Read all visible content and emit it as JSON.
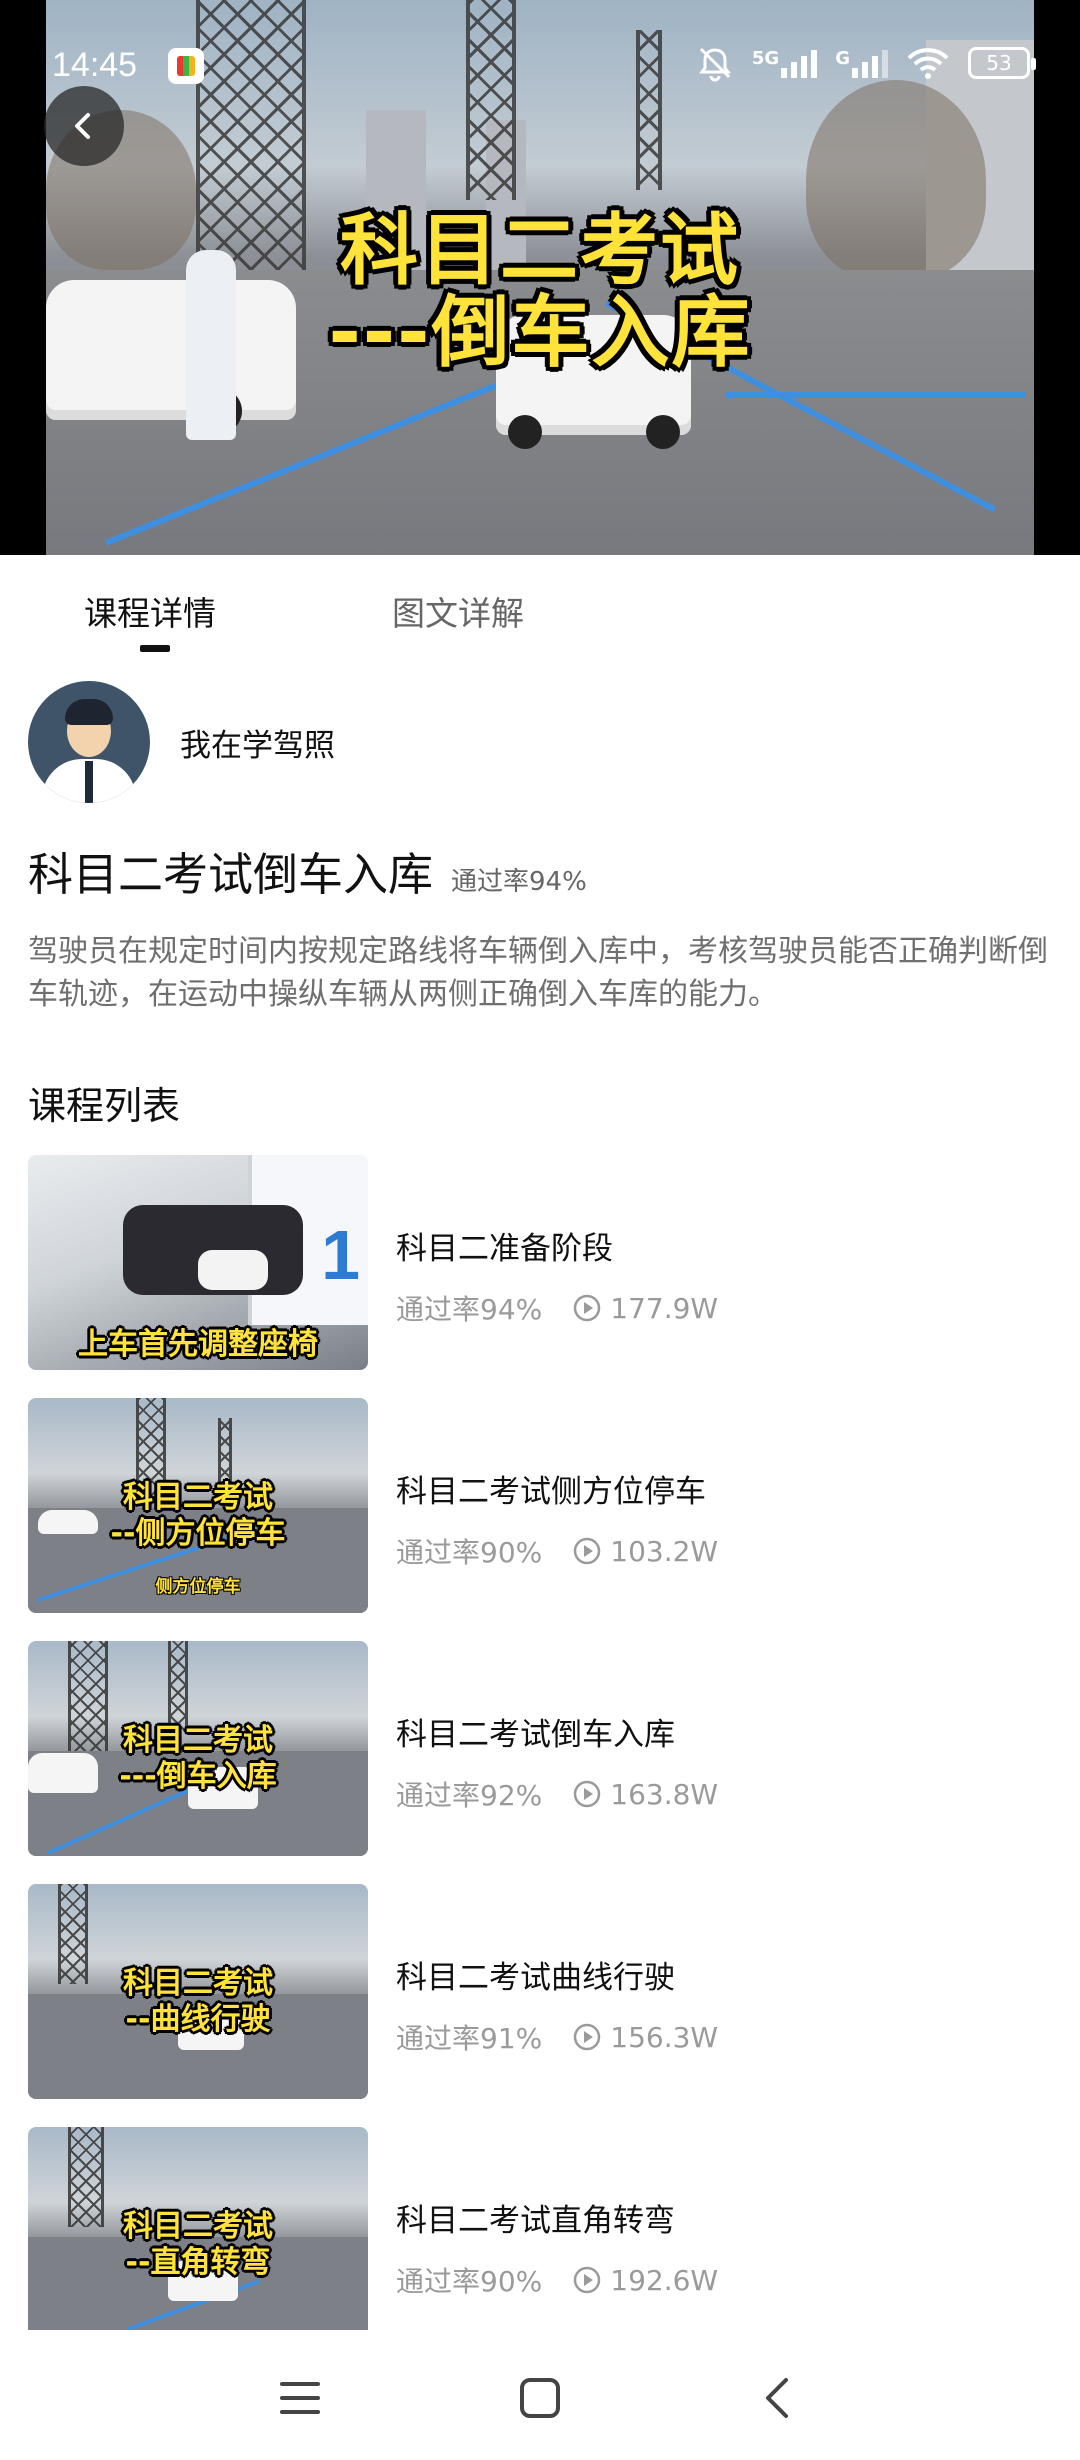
{
  "status_bar": {
    "time": "14:45",
    "network": "5G",
    "network2": "G",
    "battery": "53"
  },
  "video": {
    "title_line1": "科目二考试",
    "title_line2": "---倒车入库"
  },
  "tabs": [
    {
      "label": "课程详情",
      "active": true
    },
    {
      "label": "图文详解",
      "active": false
    }
  ],
  "author": {
    "name": "我在学驾照"
  },
  "course": {
    "title": "科目二考试倒车入库",
    "pass_rate": "通过率94%",
    "description": "驾驶员在规定时间内按规定路线将车辆倒入库中，考核驾驶员能否正确判断倒车轨迹，在运动中操纵车辆从两侧正确倒入车库的能力。"
  },
  "list_heading": "课程列表",
  "course_list": [
    {
      "title": "科目二准备阶段",
      "pass_rate": "通过率94%",
      "views": "177.9W",
      "thumb_caption1": "上车首先调整座椅",
      "thumb_caption2": "",
      "thumb_small": ""
    },
    {
      "title": "科目二考试侧方位停车",
      "pass_rate": "通过率90%",
      "views": "103.2W",
      "thumb_caption1": "科目二考试",
      "thumb_caption2": "--侧方位停车",
      "thumb_small": "侧方位停车"
    },
    {
      "title": "科目二考试倒车入库",
      "pass_rate": "通过率92%",
      "views": "163.8W",
      "thumb_caption1": "科目二考试",
      "thumb_caption2": "---倒车入库",
      "thumb_small": ""
    },
    {
      "title": "科目二考试曲线行驶",
      "pass_rate": "通过率91%",
      "views": "156.3W",
      "thumb_caption1": "科目二考试",
      "thumb_caption2": "--曲线行驶",
      "thumb_small": ""
    },
    {
      "title": "科目二考试直角转弯",
      "pass_rate": "通过率90%",
      "views": "192.6W",
      "thumb_caption1": "科目二考试",
      "thumb_caption2": "--直角转弯",
      "thumb_small": ""
    }
  ],
  "colors": {
    "caption_yellow": "#ffe23a",
    "lane_blue": "#3f8fe0",
    "muted_text": "#9a9a9a"
  },
  "icons": {
    "back": "chevron-left-icon",
    "play": "play-circle-icon",
    "nav_menu": "menu-icon",
    "nav_home": "square-icon",
    "nav_back": "chevron-left-icon"
  }
}
